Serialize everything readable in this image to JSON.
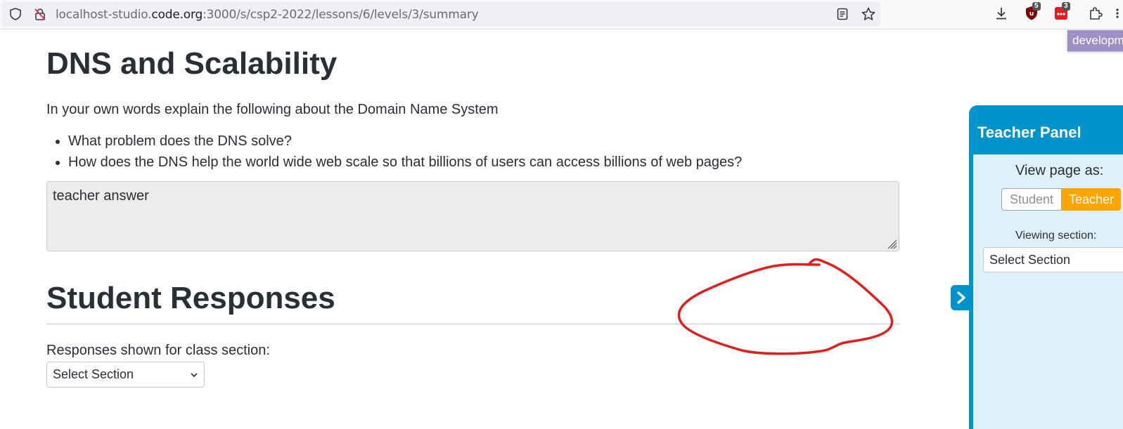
{
  "browser": {
    "url_prefix": "localhost-studio.",
    "url_host": "code.org",
    "url_suffix": ":3000/s/csp2-2022/lessons/6/levels/3/summary",
    "extensions": [
      {
        "name": "ublock-origin-icon",
        "badge": "5",
        "color": "#800000"
      },
      {
        "name": "todo-extension-icon",
        "badge": "3",
        "color": "#e02020"
      }
    ],
    "environment_tag": "developm"
  },
  "main": {
    "title": "DNS and Scalability",
    "prompt": "In your own words explain the following about the Domain Name System",
    "questions": [
      "What problem does the DNS solve?",
      "How does the DNS help the world wide web scale so that billions of users can access billions of web pages?"
    ],
    "answer": "teacher answer",
    "responses_title": "Student Responses",
    "responses_label": "Responses shown for class section:",
    "section_select": "Select Section"
  },
  "teacher_panel": {
    "title": "Teacher Panel",
    "view_as_label": "View page as:",
    "student_option": "Student",
    "teacher_option": "Teacher",
    "viewing_section_label": "Viewing section:",
    "section_select": "Select Section"
  },
  "colors": {
    "panel_blue": "#0094ca",
    "panel_body": "#dff1f8",
    "teacher_active": "#ffa400",
    "annotation_red": "#e01e1e",
    "env_tag": "#9e8fc4"
  }
}
